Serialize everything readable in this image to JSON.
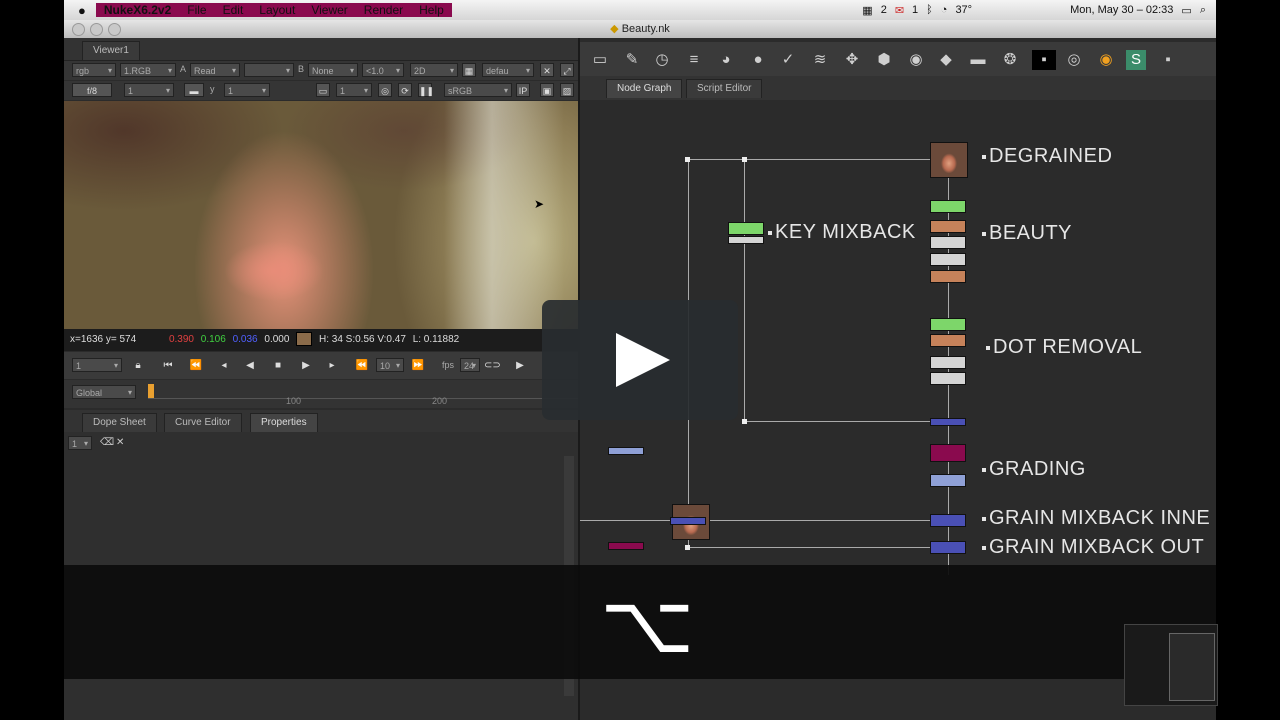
{
  "menubar": {
    "app_name": "NukeX6.2v2",
    "items": [
      "File",
      "Edit",
      "Layout",
      "Viewer",
      "Render",
      "Help"
    ],
    "calendar_badge": "2",
    "mail_badge": "1",
    "temperature": "37°",
    "datetime": "Mon, May 30 – 02:33"
  },
  "window": {
    "title": "Beauty.nk"
  },
  "viewer": {
    "tab": "Viewer1",
    "channels": "rgb",
    "layer": "1.RGB",
    "a_label": "A",
    "a_input": "Read",
    "b_label": "B",
    "b_input": "None",
    "zoom": "<1.0",
    "view_mode": "2D",
    "lut_combo": "defau",
    "frame_ratio": "f/8",
    "gain": "1",
    "y_label": "y",
    "gamma": "1",
    "proxy": "1",
    "colorspace": "sRGB",
    "status": {
      "coords": "x=1636 y= 574",
      "r": "0.390",
      "g": "0.106",
      "b": "0.036",
      "a": "0.000",
      "swatch_color": "#8a6b4a",
      "hsvl": "H: 34 S:0.56 V:0.47",
      "lum": "L: 0.11882"
    }
  },
  "transport": {
    "frame": "1",
    "increment": "10",
    "fps_label": "fps",
    "fps": "24"
  },
  "timeline": {
    "range_mode": "Global",
    "ticks": [
      "100",
      "200"
    ]
  },
  "properties_panel": {
    "tabs": [
      "Dope Sheet",
      "Curve Editor",
      "Properties"
    ],
    "max_panels": "1"
  },
  "nodegraph": {
    "tabs": [
      "Node Graph",
      "Script Editor"
    ],
    "labels": {
      "degrained": "DEGRAINED",
      "key_mixback": "KEY MIXBACK",
      "beauty": "BEAUTY",
      "dot_removal": "DOT REMOVAL",
      "grading": "GRADING",
      "grain_mixback_inner": "GRAIN MIXBACK INNE",
      "grain_mixback_outer": "GRAIN MIXBACK OUT"
    }
  },
  "overlay": {
    "key_glyph": "⌥"
  },
  "colors": {
    "green_node": "#7dd66a",
    "orange_node": "#c6825a",
    "grey_node": "#d4d4d4",
    "blue_node": "#4a50b5",
    "light_blue_node": "#8fa0d6",
    "magenta_node": "#8a0a4e"
  }
}
